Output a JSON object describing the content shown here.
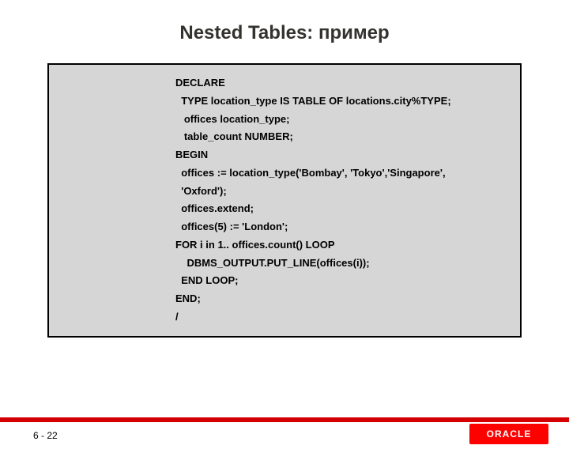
{
  "title": "Nested Tables: пример",
  "code": [
    "DECLARE",
    "  TYPE location_type IS TABLE OF locations.city%TYPE;",
    "   offices location_type;",
    "   table_count NUMBER;",
    "BEGIN",
    "  offices := location_type('Bombay', 'Tokyo','Singapore',",
    "  'Oxford');",
    "  offices.extend;",
    "  offices(5) := 'London';",
    "FOR i in 1.. offices.count() LOOP",
    "    DBMS_OUTPUT.PUT_LINE(offices(i));",
    "  END LOOP;",
    "END;",
    "/"
  ],
  "page_number": "6 - 22",
  "logo_text": "ORACLE",
  "colors": {
    "accent": "#d40000",
    "code_bg": "#d6d6d6"
  }
}
